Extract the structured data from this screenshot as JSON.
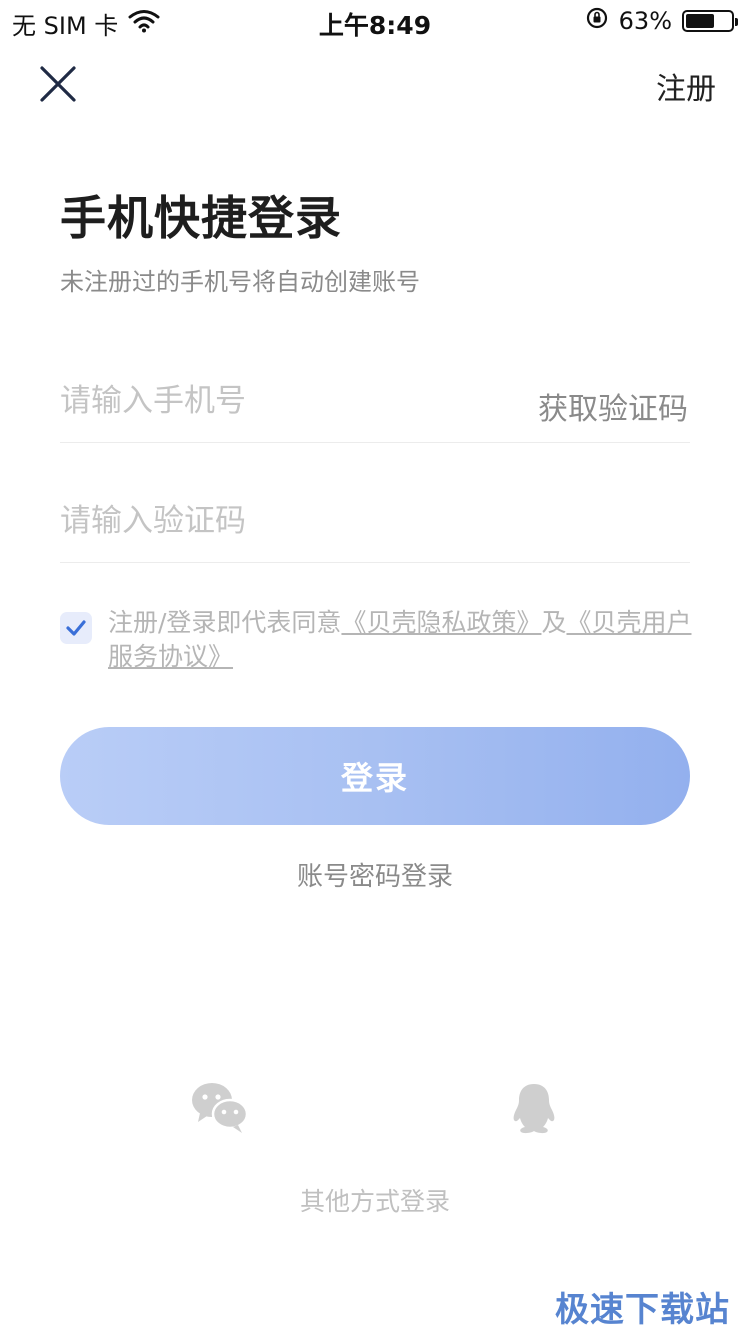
{
  "status_bar": {
    "carrier": "无 SIM 卡",
    "time": "上午8:49",
    "battery_percent": "63%",
    "battery_level": 0.63,
    "icons": [
      "wifi-icon",
      "rotation-lock-icon",
      "battery-icon"
    ]
  },
  "header": {
    "close_icon": "close-icon",
    "register_label": "注册"
  },
  "page": {
    "title": "手机快捷登录",
    "subtitle": "未注册过的手机号将自动创建账号"
  },
  "form": {
    "phone_placeholder": "请输入手机号",
    "phone_value": "",
    "get_code_label": "获取验证码",
    "code_placeholder": "请输入验证码",
    "code_value": ""
  },
  "agreement": {
    "checked": true,
    "prefix": "注册/登录即代表同意",
    "privacy_link": "《贝壳隐私政策》",
    "conjunction": "及",
    "terms_link": "《贝壳用户服务协议》"
  },
  "actions": {
    "login_label": "登录",
    "password_login_label": "账号密码登录"
  },
  "other_login": {
    "label": "其他方式登录",
    "options": [
      "wechat-icon",
      "qq-icon"
    ]
  },
  "watermark": "极速下载站",
  "colors": {
    "login_gradient_start": "#b9cdf7",
    "login_gradient_end": "#93b0ee",
    "checkbox_bg": "#e7ecfb",
    "check_mark": "#3a6fd8"
  }
}
